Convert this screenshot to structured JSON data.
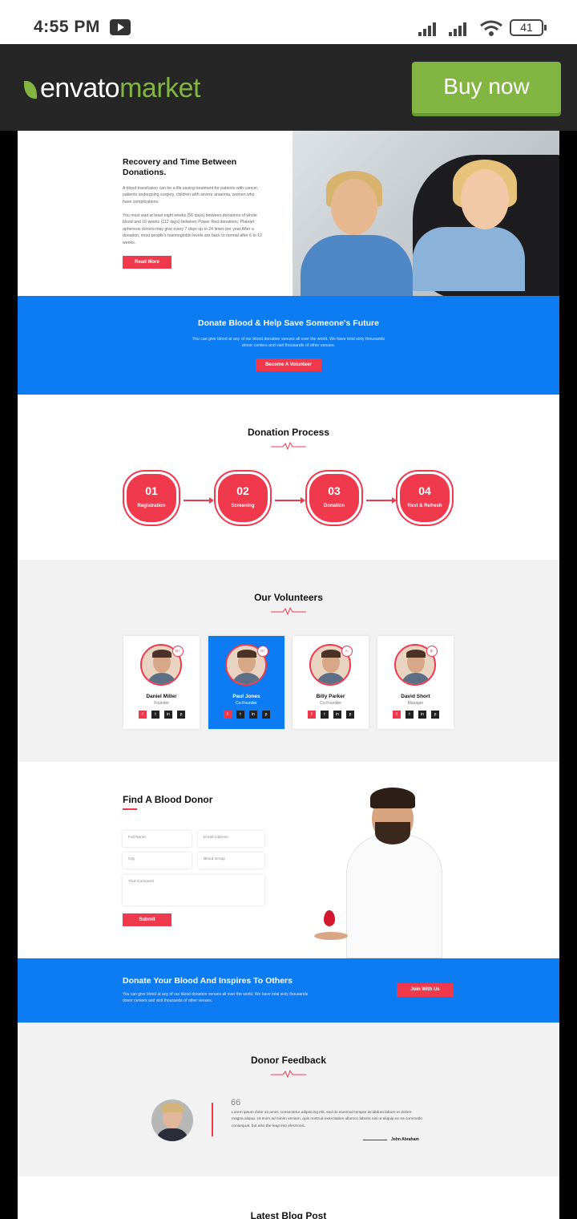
{
  "status_bar": {
    "time": "4:55 PM",
    "battery": "41"
  },
  "topbar": {
    "logo_envato": "envato",
    "logo_market": "market",
    "buy_label": "Buy now"
  },
  "recovery": {
    "title": "Recovery and Time Between Donations.",
    "para1": "A blood transfusion can be a life saving treatment for patients with cancer, patients undergoing surgery, children with severe anaemia, women who have complications.",
    "para2": "You must wait at least eight weeks (56 days) between donations of whole blood and 16 weeks (112 days) between Power Red donations. Platelet apheresis donors may give every 7 days up to 24 times per year.After a donation, most people's haemoglobin levels are back to normal after 6 to 12 weeks.",
    "button": "Read More"
  },
  "band1": {
    "title": "Donate Blood & Help Save Someone's Future",
    "text": "You can give blood at any of our blood donation venues all over the world. We have total sixty thousands donor centers and visit thousands of other venues.",
    "button": "Become A Volunteer"
  },
  "process": {
    "title": "Donation Process",
    "steps": [
      {
        "num": "01",
        "label": "Registration"
      },
      {
        "num": "02",
        "label": "Screening"
      },
      {
        "num": "03",
        "label": "Donation"
      },
      {
        "num": "04",
        "label": "Rest & Refresh"
      }
    ]
  },
  "volunteers": {
    "title": "Our Volunteers",
    "items": [
      {
        "name": "Daniel Miller",
        "role": "Founder",
        "blood": "B+"
      },
      {
        "name": "Paul Jones",
        "role": "Co-Founder",
        "blood": "O+"
      },
      {
        "name": "Billy Parker",
        "role": "Co-Founder",
        "blood": "A-"
      },
      {
        "name": "David Short",
        "role": "Manager",
        "blood": "B-"
      }
    ],
    "social": [
      "f",
      "t",
      "in",
      "p"
    ]
  },
  "find": {
    "title": "Find A Blood Donor",
    "full_name": "Full Name",
    "email": "Email Address",
    "city": "City",
    "blood_group": "Blood Group",
    "comment": "Your Comment",
    "submit": "Submit"
  },
  "band2": {
    "title": "Donate Your Blood And Inspires To Others",
    "text": "You can give blood at any of our blood donation venues all over the world. We have total sixty thousands donor centers and visit thousands of other venues.",
    "button": "Join With Us"
  },
  "feedback": {
    "title": "Donor Feedback",
    "quote_mark": "66",
    "text": "Lorem ipsum dolor sit amet, consectetur adipiscing elit, sed do eiusmod tempor incididunt labore et dolore magna aliqua. Ut enim ad minim veniam, quis nostrud exercitation ullamco laboris nisi ut aliquip ex ea commodo consequat. but also the leap into electronic.",
    "author": "John Abraham"
  },
  "blog": {
    "title": "Latest Blog Post"
  },
  "colors": {
    "brand_green": "#82b541",
    "accent_red": "#f1394e",
    "blue": "#0d7bf2",
    "dark_bar": "#262626"
  }
}
